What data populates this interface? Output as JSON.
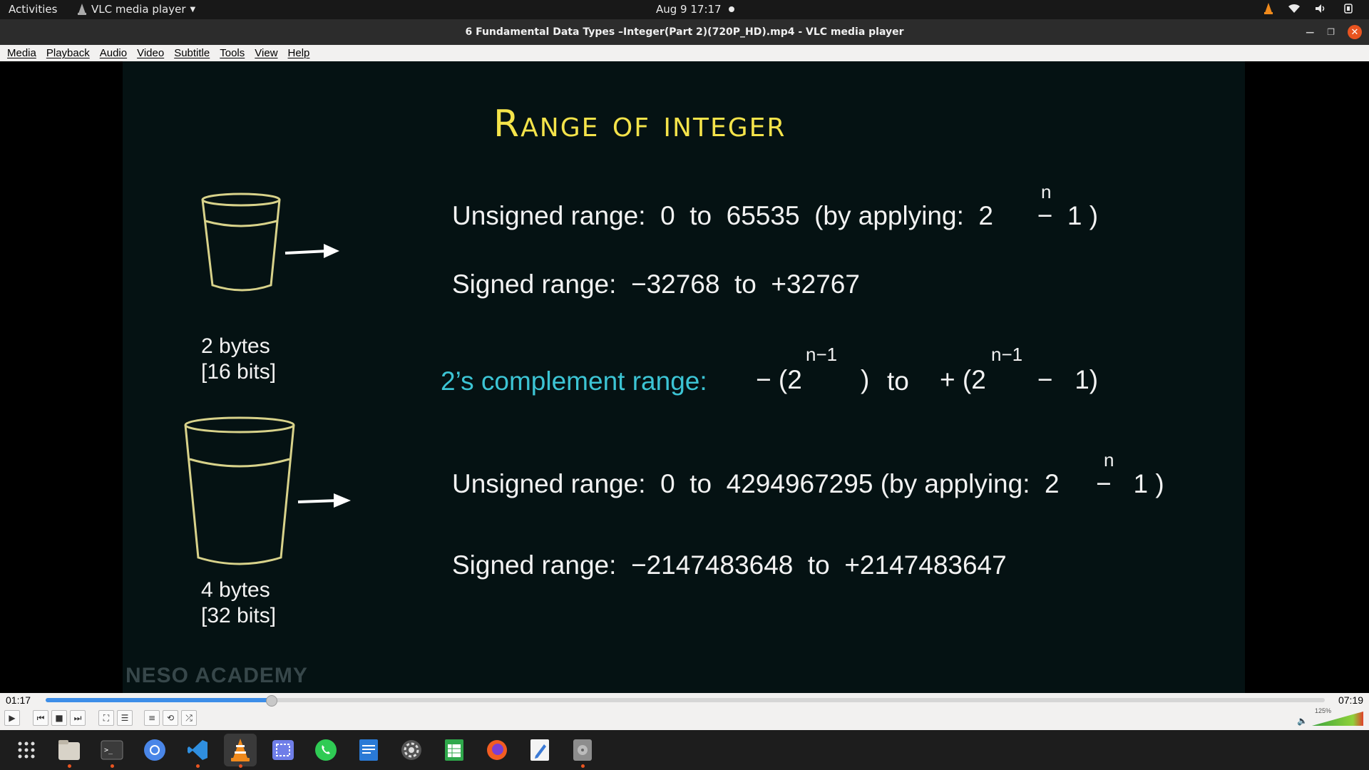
{
  "topbar": {
    "activities": "Activities",
    "app_menu": "VLC media player",
    "clock": "Aug 9  17:17"
  },
  "window": {
    "title": "6 Fundamental Data Types –Integer(Part 2)(720P_HD).mp4 - VLC media player"
  },
  "menu": [
    "Media",
    "Playback",
    "Audio",
    "Video",
    "Subtitle",
    "Tools",
    "View",
    "Help"
  ],
  "slide": {
    "title": "Range of integer",
    "upper": {
      "unsigned": "Unsigned range:  0  to  65535  (by applying:  2      −  1 )",
      "unsigned_exp": "n",
      "signed": "Signed range:  −32768  to  +32767",
      "caption_1": "2 bytes",
      "caption_2": "[16 bits]"
    },
    "complement": {
      "label": "2’s complement range:",
      "lhs": "− (2        )",
      "lhs_exp": "n−1",
      "mid": "to",
      "rhs": "+ (2       −   1)",
      "rhs_exp": "n−1"
    },
    "lower": {
      "unsigned": "Unsigned range:  0  to  4294967295 (by applying:  2     −   1 )",
      "unsigned_exp": "n",
      "signed": "Signed range:  −2147483648  to  +2147483647",
      "caption_1": "4 bytes",
      "caption_2": "[32 bits]"
    },
    "watermark": "NESO ACADEMY"
  },
  "player": {
    "elapsed": "01:17",
    "total": "07:19",
    "progress_fraction": 0.176,
    "volume": "125%",
    "volume_fraction": 1.0
  },
  "colors": {
    "title_yellow": "#f4e34a",
    "complement_cyan": "#3cc4d4",
    "seek_blue": "#3d8ee8",
    "accent_orange": "#e95420"
  },
  "icons": {
    "tray": [
      "vlc-tray-icon",
      "wifi-icon",
      "speaker-icon",
      "power-icon"
    ],
    "taskbar": [
      "app-grid-icon",
      "files-icon",
      "terminal-icon",
      "chromium-icon",
      "vscode-icon",
      "vlc-icon",
      "screenshot-icon",
      "whatsapp-icon",
      "writer-icon",
      "settings-icon",
      "calc-icon",
      "firefox-icon",
      "text-editor-icon",
      "disk-icon"
    ]
  }
}
